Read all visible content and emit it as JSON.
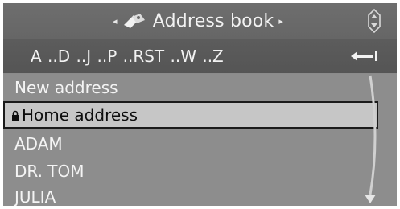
{
  "header": {
    "title": "Address book",
    "prev_arrow": "◂",
    "next_arrow": "▸"
  },
  "alphabet_bar": {
    "label": "A ..D ..J ..P ..RST ..W ..Z"
  },
  "list": {
    "items": [
      {
        "label": "New address",
        "locked": false,
        "selected": false
      },
      {
        "label": "Home address",
        "locked": true,
        "selected": true
      },
      {
        "label": "ADAM",
        "locked": false,
        "selected": false
      },
      {
        "label": "DR. TOM",
        "locked": false,
        "selected": false
      },
      {
        "label": "JULIA",
        "locked": false,
        "selected": false
      }
    ]
  },
  "colors": {
    "header_bg": "#6a6a6a",
    "alpha_bg": "#585858",
    "list_bg": "#8d8d8d",
    "selected_bg": "#c6c6c6",
    "text": "#f4f4f4",
    "selected_text": "#0d0d0d"
  },
  "icons": {
    "header": "address-book-icon",
    "controller": "controller-direction-icon",
    "back": "back-arrow-icon",
    "lock": "lock-icon",
    "scroll": "scroll-down-icon"
  }
}
